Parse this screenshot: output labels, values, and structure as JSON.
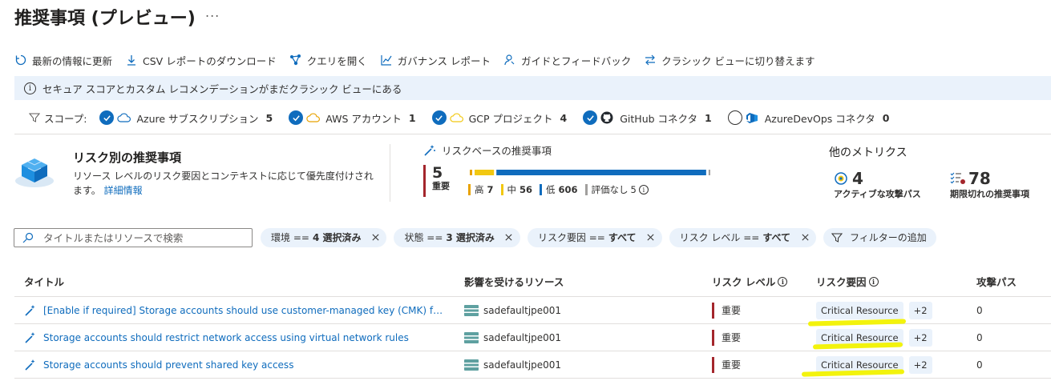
{
  "header": {
    "title": "推奨事項 (プレビュー)",
    "more": "..."
  },
  "toolbar": [
    {
      "icon": "refresh-icon",
      "label": "最新の情報に更新"
    },
    {
      "icon": "download-icon",
      "label": "CSV レポートのダウンロード"
    },
    {
      "icon": "query-icon",
      "label": "クエリを開く"
    },
    {
      "icon": "chart-icon",
      "label": "ガバナンス レポート"
    },
    {
      "icon": "feedback-icon",
      "label": "ガイドとフィードバック"
    },
    {
      "icon": "switch-icon",
      "label": "クラシック ビューに切り替えます"
    }
  ],
  "banner": {
    "text": "セキュア スコアとカスタム レコメンデーションがまだクラシック ビューにある"
  },
  "scope": {
    "label": "スコープ:",
    "items": [
      {
        "name": "Azure サブスクリプション",
        "count": "5",
        "checked": true,
        "icon": "azure-cloud-icon"
      },
      {
        "name": "AWS アカウント",
        "count": "1",
        "checked": true,
        "icon": "aws-cloud-icon"
      },
      {
        "name": "GCP プロジェクト",
        "count": "4",
        "checked": true,
        "icon": "gcp-cloud-icon"
      },
      {
        "name": "GitHub コネクタ",
        "count": "1",
        "checked": true,
        "icon": "github-icon"
      },
      {
        "name": "AzureDevOps コネクタ",
        "count": "0",
        "checked": false,
        "icon": "azure-devops-icon"
      }
    ]
  },
  "risk_panel": {
    "title": "リスク別の推奨事項",
    "description": "リソース レベルのリスク要因とコンテキストに応じて優先度付けされます。",
    "link": "詳細情報"
  },
  "risk_based": {
    "title": "リスクベースの推奨事項",
    "critical_count": "5",
    "critical_label": "重要",
    "legend": [
      {
        "label": "高",
        "value": "7",
        "color": "#e8a200"
      },
      {
        "label": "中",
        "value": "56",
        "color": "#f2c811"
      },
      {
        "label": "低",
        "value": "606",
        "color": "#0f6cbd"
      },
      {
        "label": "評価なし",
        "value": "5",
        "color": "#a19f9d"
      }
    ]
  },
  "other_metrics": {
    "title": "他のメトリクス",
    "attack_paths": {
      "value": "4",
      "label": "アクティブな攻撃パス"
    },
    "overdue": {
      "value": "78",
      "label": "期限切れの推奨事項"
    }
  },
  "filters": {
    "search_placeholder": "タイトルまたはリソースで検索",
    "pills": [
      {
        "key": "環境 ==",
        "value": "4 選択済み"
      },
      {
        "key": "状態 ==",
        "value": "3 選択済み"
      },
      {
        "key": "リスク要因 ==",
        "value": "すべて"
      },
      {
        "key": "リスク レベル ==",
        "value": "すべて"
      }
    ],
    "add_filter": "フィルターの追加"
  },
  "table": {
    "headers": {
      "title": "タイトル",
      "resource": "影響を受けるリソース",
      "risk_level": "リスク レベル",
      "risk_factors": "リスク要因",
      "attack_paths": "攻撃パス"
    },
    "rows": [
      {
        "title": "[Enable if required] Storage accounts should use customer-managed key (CMK) for en...",
        "resource": "sadefaultjpe001",
        "risk_level": "重要",
        "factor": "Critical Resource",
        "more": "+2",
        "attack_paths": "0"
      },
      {
        "title": "Storage accounts should restrict network access using virtual network rules",
        "resource": "sadefaultjpe001",
        "risk_level": "重要",
        "factor": "Critical Resource",
        "more": "+2",
        "attack_paths": "0"
      },
      {
        "title": "Storage accounts should prevent shared key access",
        "resource": "sadefaultjpe001",
        "risk_level": "重要",
        "factor": "Critical Resource",
        "more": "+2",
        "attack_paths": "0"
      }
    ]
  }
}
